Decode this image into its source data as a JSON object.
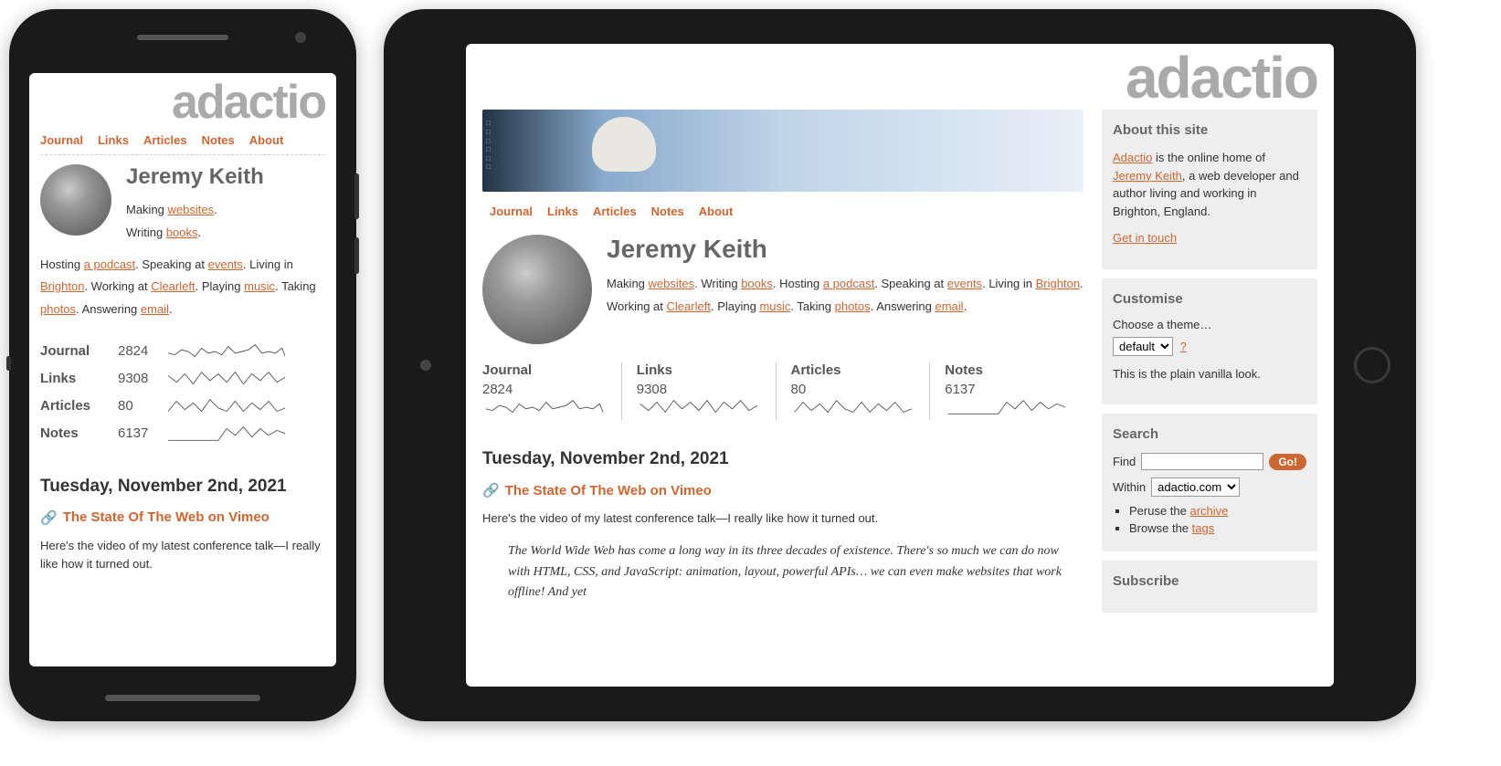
{
  "logo": "adactio",
  "nav": {
    "journal": "Journal",
    "links": "Links",
    "articles": "Articles",
    "notes": "Notes",
    "about": "About"
  },
  "author": "Jeremy Keith",
  "bio": {
    "making": "Making ",
    "websites": "websites",
    "period": ".",
    "writing": "Writing ",
    "books": "books",
    "hosting": "Hosting ",
    "podcast": "a podcast",
    "speaking": "Speaking at ",
    "events": "events",
    "living": "Living in ",
    "brighton": "Brighton",
    "working": "Working at ",
    "clearleft": "Clearleft",
    "playing": "Playing ",
    "music": "music",
    "taking": "Taking ",
    "photos": "photos",
    "answering": "Answering ",
    "email": "email"
  },
  "counts": {
    "journal": {
      "label": "Journal",
      "value": "2824"
    },
    "links": {
      "label": "Links",
      "value": "9308"
    },
    "articles": {
      "label": "Articles",
      "value": "80"
    },
    "notes": {
      "label": "Notes",
      "value": "6137"
    }
  },
  "post": {
    "date": "Tuesday, November 2nd, 2021",
    "title": "The State Of The Web on Vimeo",
    "excerpt": "Here's the video of my latest conference talk—I really like how it turned out.",
    "quote": "The World Wide Web has come a long way in its three decades of existence. There's so much we can do now with HTML, CSS, and JavaScript: animation, layout, powerful APIs… we can even make websites that work offline! And yet"
  },
  "sidebar": {
    "about": {
      "heading": "About this site",
      "adactio": "Adactio",
      "text1": " is the online home of ",
      "jeremy": "Jeremy Keith",
      "text2": ", a web developer and author living and working in Brighton, England.",
      "contact": "Get in touch"
    },
    "customise": {
      "heading": "Customise",
      "label": "Choose a theme…",
      "selected": "default",
      "help": "?",
      "desc": "This is the plain vanilla look."
    },
    "search": {
      "heading": "Search",
      "find_label": "Find",
      "go": "Go!",
      "within_label": "Within",
      "within_selected": "adactio.com",
      "peruse": "Peruse the ",
      "archive": "archive",
      "browse": "Browse the ",
      "tags": "tags"
    },
    "subscribe": {
      "heading": "Subscribe"
    }
  }
}
